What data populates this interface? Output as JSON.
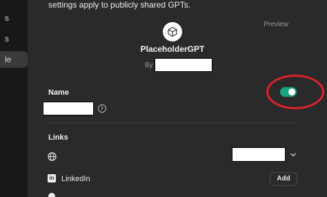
{
  "sidebar": {
    "items": [
      {
        "label": "s"
      },
      {
        "label": "s"
      },
      {
        "label": "le"
      }
    ]
  },
  "panel": {
    "top_note": "settings apply to publicly shared GPTs.",
    "preview_label": "Preview",
    "gpt_name": "PlaceholderGPT",
    "by_prefix": "By",
    "name_label": "Name",
    "links_label": "Links",
    "linkedin_label": "LinkedIn",
    "add_label": "Add"
  },
  "toggle": {
    "state": "on"
  },
  "colors": {
    "toggle_on": "#19a37f",
    "annotation_circle": "#e0202a"
  },
  "icons": [
    "gpt-logo-icon",
    "info-icon",
    "globe-icon",
    "chevron-down-icon",
    "linkedin-icon"
  ]
}
